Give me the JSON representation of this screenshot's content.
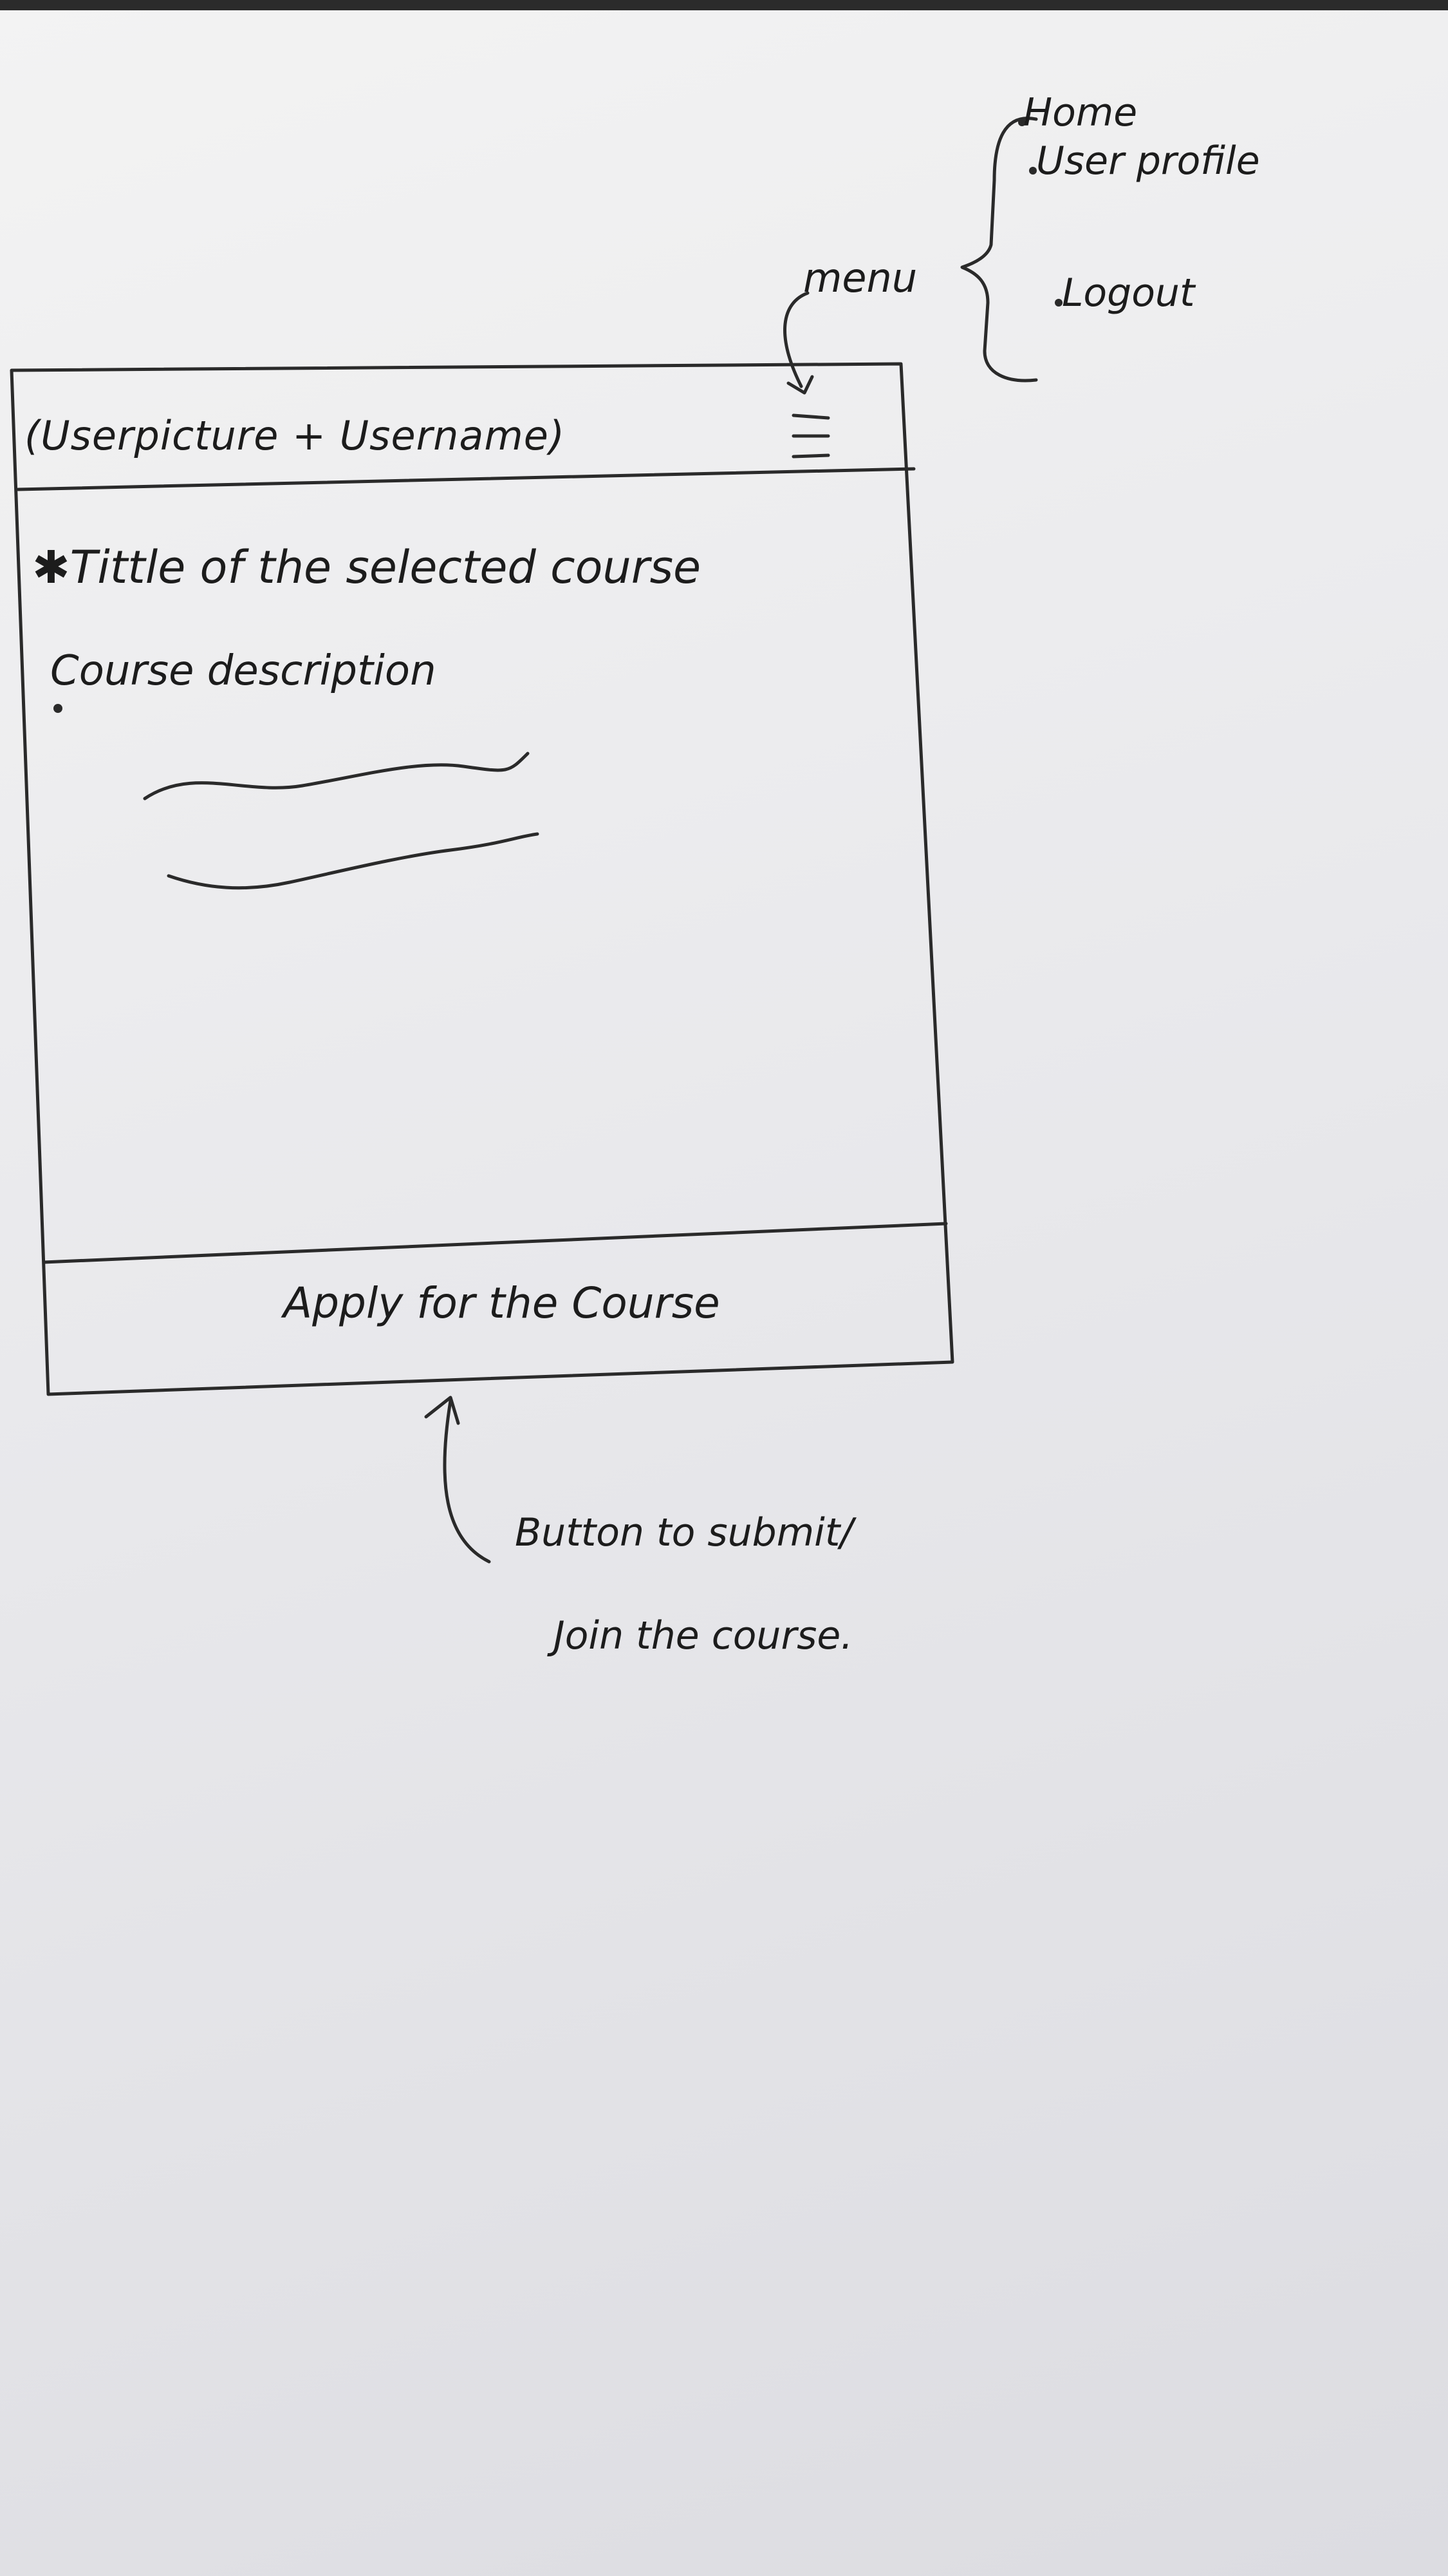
{
  "header": {
    "label": "(Userpicture + Username)"
  },
  "menu": {
    "annotation": "menu",
    "items": [
      "Home",
      "User profile",
      "Logout"
    ]
  },
  "content": {
    "title": "Tittle of the selected course",
    "description": "Course description"
  },
  "footer": {
    "button_label": "Apply for the Course"
  },
  "note": {
    "line1": "Button to submit/",
    "line2": "Join the course."
  }
}
